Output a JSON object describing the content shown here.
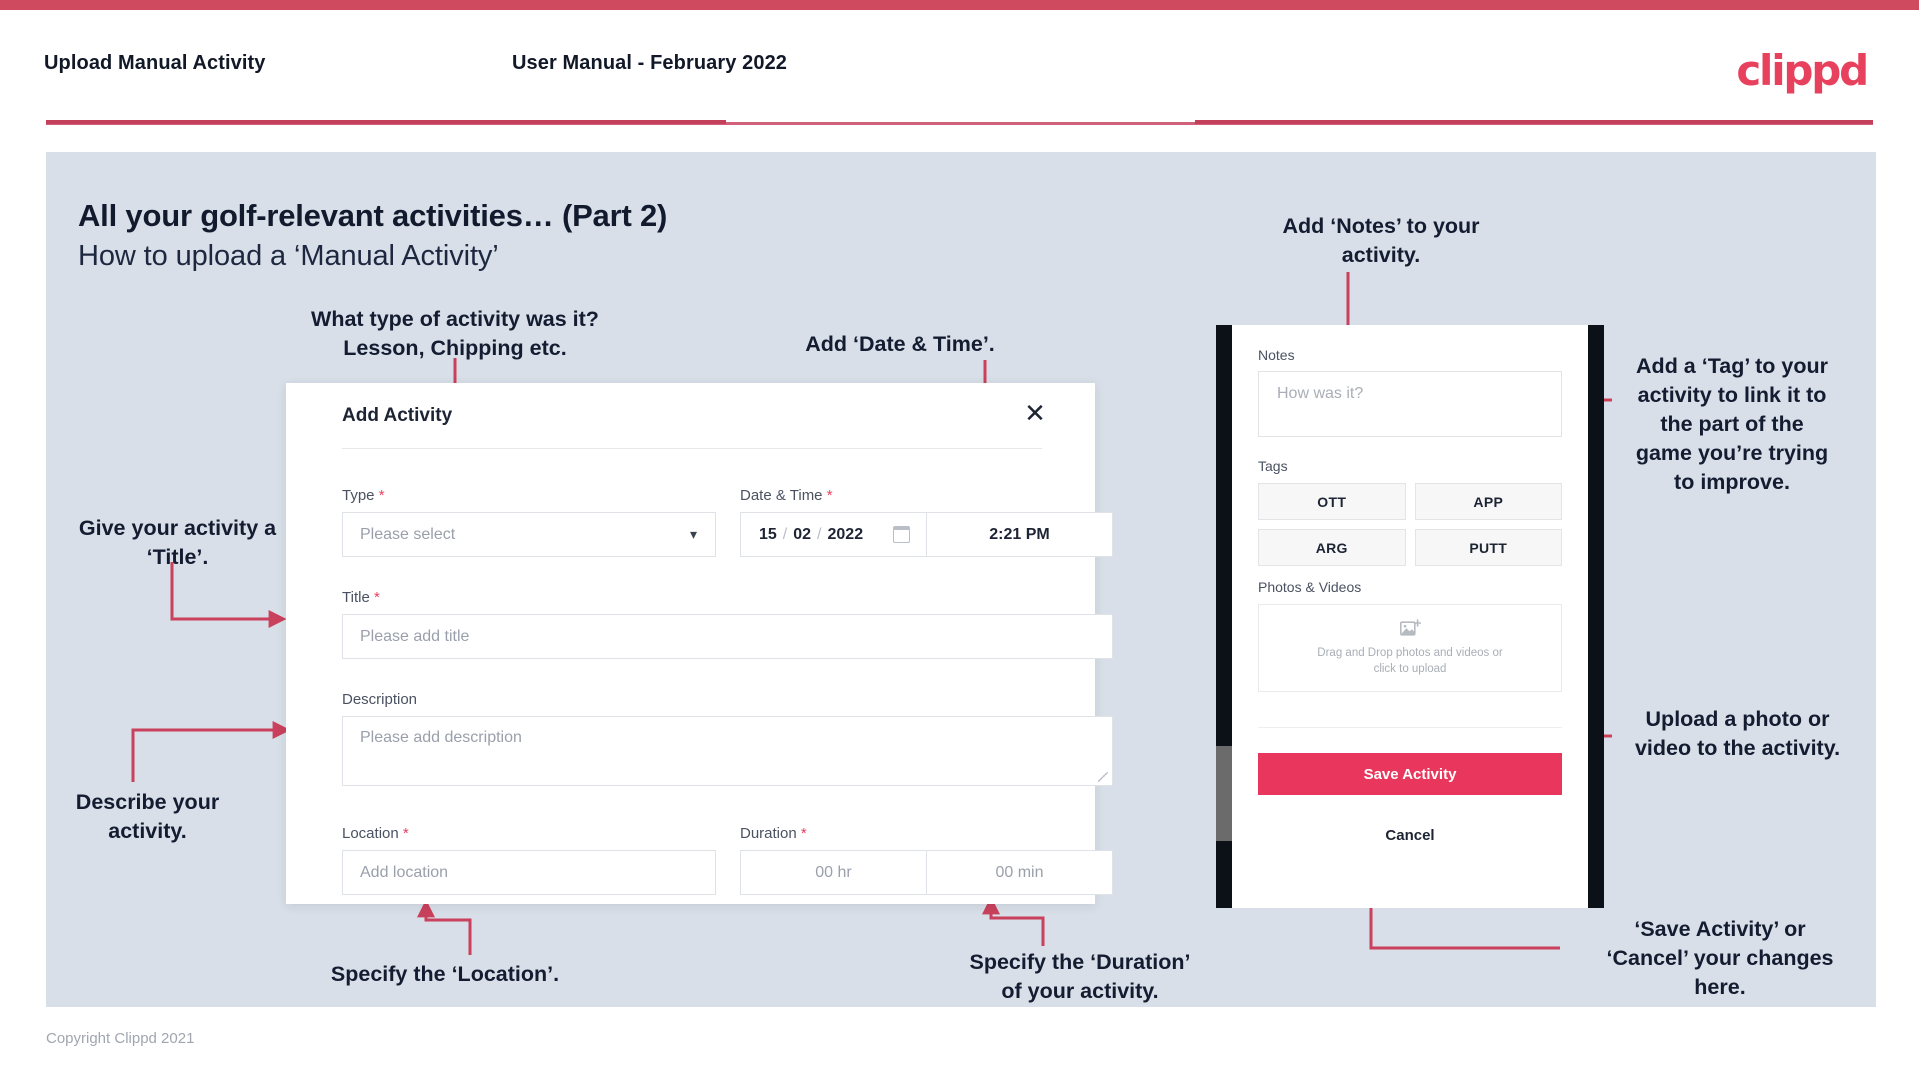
{
  "header": {
    "title": "Upload Manual Activity",
    "subtitle": "User Manual - February 2022",
    "logo": "clippd"
  },
  "slide": {
    "title": "All your golf-relevant activities… (Part 2)",
    "subtitle": "How to upload a ‘Manual Activity’"
  },
  "annotations": {
    "type": "What type of activity was it?\nLesson, Chipping etc.",
    "date_time": "Add ‘Date & Time’.",
    "title_field": "Give your activity a\n‘Title’.",
    "description": "Describe your\nactivity.",
    "location": "Specify the ‘Location’.",
    "duration": "Specify the ‘Duration’\nof your activity.",
    "notes": "Add ‘Notes’ to your\nactivity.",
    "tags": "Add a ‘Tag’ to your\nactivity to link it to\nthe part of the\ngame you’re trying\nto improve.",
    "upload": "Upload a photo or\nvideo to the activity.",
    "save_cancel": "‘Save Activity’ or\n‘Cancel’ your changes\nhere."
  },
  "dialog": {
    "title": "Add Activity",
    "close_icon": "close-icon",
    "fields": {
      "type": {
        "label": "Type",
        "required": "*",
        "placeholder": "Please select",
        "chevron": "chevron-down-icon"
      },
      "date_time": {
        "label": "Date & Time",
        "required": "*",
        "day": "15",
        "month": "02",
        "year": "2022",
        "separator": "/",
        "calendar_icon": "calendar-icon",
        "time": "2:21 PM"
      },
      "title": {
        "label": "Title",
        "required": "*",
        "placeholder": "Please add title"
      },
      "description": {
        "label": "Description",
        "required": "",
        "placeholder": "Please add description"
      },
      "location": {
        "label": "Location",
        "required": "*",
        "placeholder": "Add location"
      },
      "duration": {
        "label": "Duration",
        "required": "*",
        "hours_placeholder": "00 hr",
        "minutes_placeholder": "00 min"
      }
    }
  },
  "phone": {
    "notes": {
      "label": "Notes",
      "placeholder": "How was it?"
    },
    "tags": {
      "label": "Tags",
      "items": [
        "OTT",
        "APP",
        "ARG",
        "PUTT"
      ]
    },
    "photos": {
      "label": "Photos & Videos",
      "icon": "add-image-icon",
      "line1": "Drag and Drop photos and videos or",
      "line2": "click to upload"
    },
    "save_label": "Save Activity",
    "cancel_label": "Cancel"
  },
  "footer": {
    "copyright": "Copyright Clippd 2021"
  },
  "colors": {
    "brand_pink": "#e8415e",
    "save_pink": "#e8365c",
    "top_bar": "#cf4a5f",
    "slide_bg": "#d8dfe8",
    "connector": "#c9415c",
    "ink": "#141c31"
  }
}
